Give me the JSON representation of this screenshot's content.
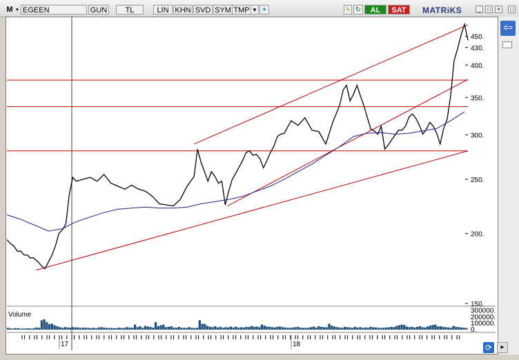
{
  "toolbar": {
    "app_letter": "M",
    "symbol": "EGEEN",
    "period": "GUN",
    "currency": "TL",
    "scale": "LIN",
    "buttons": [
      "KHN",
      "SVD",
      "SYM",
      "TMP"
    ],
    "buy_label": "AL",
    "sell_label": "SAT",
    "brand": "MATRiKS",
    "colors": {
      "buy": "#1a8a1a",
      "sell": "#c81e1e",
      "brand": "#2a3a7a"
    }
  },
  "chart_data": [
    {
      "type": "line",
      "title": "",
      "x_tick_labels": [
        "17",
        "18"
      ],
      "y_tick_labels": [
        "450.",
        "430.",
        "400.",
        "350.",
        "300.",
        "250.",
        "200.",
        "150."
      ],
      "y_scale": "log",
      "ylim": [
        150,
        480
      ],
      "grid": false,
      "series": [
        {
          "x": [
            0,
            5,
            10,
            15,
            20,
            25,
            30,
            33,
            38,
            45,
            50,
            55,
            60,
            65,
            70,
            75,
            80,
            85,
            90,
            95,
            100,
            110,
            120,
            130,
            140,
            150,
            160,
            170,
            180,
            190,
            200,
            210,
            220,
            230,
            240,
            250,
            260,
            270,
            275,
            280,
            285,
            290,
            295,
            300,
            305,
            310,
            315,
            320,
            325,
            330,
            335,
            340,
            345,
            350,
            355,
            360,
            365,
            370,
            375,
            380,
            385,
            390,
            395,
            400,
            410,
            420,
            430,
            440,
            450,
            460,
            470,
            480,
            485,
            490,
            495,
            500,
            505,
            510,
            515,
            520,
            525,
            530,
            535,
            540,
            545,
            550,
            555,
            560,
            565,
            570,
            575,
            580,
            585,
            590,
            595,
            600,
            605,
            610,
            615,
            620,
            625,
            630,
            635,
            640,
            645,
            650,
            655,
            660,
            665
          ],
          "values": [
            195,
            192,
            190,
            186,
            186,
            183,
            183,
            181,
            181,
            178,
            175,
            173,
            178,
            183,
            190,
            200,
            203,
            208,
            235,
            252,
            248,
            250,
            252,
            248,
            255,
            246,
            243,
            240,
            244,
            240,
            238,
            233,
            226,
            225,
            224,
            230,
            243,
            253,
            283,
            268,
            258,
            248,
            258,
            253,
            246,
            248,
            225,
            238,
            250,
            256,
            263,
            270,
            279,
            281,
            276,
            277,
            272,
            262,
            270,
            279,
            286,
            298,
            301,
            302,
            318,
            312,
            322,
            306,
            304,
            289,
            316,
            339,
            361,
            368,
            345,
            355,
            368,
            352,
            338,
            322,
            307,
            305,
            301,
            311,
            283,
            288,
            294,
            300,
            306,
            306,
            311,
            323,
            327,
            321,
            312,
            301,
            307,
            316,
            311,
            302,
            289,
            308,
            320,
            352,
            407,
            427,
            452,
            473,
            443
          ],
          "color": "#000000"
        },
        {
          "name": "",
          "x": [
            0,
            20,
            40,
            60,
            80,
            100,
            120,
            140,
            160,
            180,
            200,
            220,
            240,
            260,
            280,
            300,
            320,
            340,
            360,
            380,
            400,
            420,
            440,
            460,
            480,
            500,
            520,
            540,
            560,
            580,
            600,
            620,
            640,
            660
          ],
          "values": [
            216,
            212,
            207,
            202,
            204,
            210,
            214,
            218,
            221,
            222,
            223,
            222,
            222,
            223,
            226,
            228,
            230,
            233,
            238,
            243,
            250,
            258,
            266,
            276,
            286,
            298,
            302,
            303,
            301,
            302,
            305,
            308,
            318,
            330
          ],
          "color": "#1f1f8c"
        }
      ],
      "horizontal_lines": [
        {
          "value": 376,
          "color": "#c00000"
        },
        {
          "value": 337,
          "color": "#c00000"
        },
        {
          "value": 281,
          "color": "#c00000"
        }
      ],
      "trend_lines": [
        {
          "from": [
            42,
            172
          ],
          "to": [
            665,
            281
          ],
          "color": "#c00000"
        },
        {
          "from": [
            270,
            289
          ],
          "to": [
            665,
            472
          ],
          "color": "#c00000"
        },
        {
          "from": [
            318,
            224
          ],
          "to": [
            665,
            377
          ],
          "color": "#c00000"
        }
      ]
    },
    {
      "type": "bar",
      "title": "Volume",
      "y_tick_labels": [
        "300000.",
        "200000.",
        "100000.",
        "0."
      ],
      "ylim": [
        0,
        330000
      ],
      "values": [
        30000,
        20000,
        18000,
        25000,
        22000,
        15000,
        18000,
        20000,
        22000,
        17000,
        25000,
        35000,
        30000,
        150000,
        165000,
        120000,
        90000,
        95000,
        70000,
        55000,
        40000,
        30000,
        42000,
        36000,
        32000,
        40000,
        36000,
        35000,
        28000,
        30000,
        32000,
        27000,
        25000,
        30000,
        22000,
        35000,
        40000,
        32000,
        30000,
        25000,
        28000,
        22000,
        25000,
        32000,
        25000,
        30000,
        40000,
        32000,
        30000,
        80000,
        40000,
        55000,
        30000,
        60000,
        50000,
        42000,
        32000,
        120000,
        55000,
        70000,
        80000,
        40000,
        45000,
        55000,
        35000,
        30000,
        45000,
        30000,
        30000,
        28000,
        40000,
        30000,
        25000,
        30000,
        150000,
        95000,
        90000,
        60000,
        45000,
        40000,
        55000,
        35000,
        45000,
        30000,
        40000,
        35000,
        48000,
        35000,
        48000,
        30000,
        40000,
        35000,
        45000,
        40000,
        60000,
        45000,
        50000,
        40000,
        80000,
        65000,
        48000,
        45000,
        40000,
        35000,
        45000,
        50000,
        40000,
        35000,
        30000,
        30000,
        35000,
        40000,
        45000,
        30000,
        30000,
        28000,
        32000,
        40000,
        50000,
        35000,
        55000,
        45000,
        40000,
        38000,
        95000,
        65000,
        50000,
        40000,
        35000,
        30000,
        45000,
        40000,
        35000,
        30000,
        45000,
        32000,
        40000,
        30000,
        35000,
        30000,
        45000,
        38000,
        35000,
        30000,
        28000,
        32000,
        35000,
        38000,
        45000,
        40000,
        60000,
        70000,
        80000,
        75000,
        48000,
        40000,
        45000,
        35000,
        45000,
        55000,
        40000,
        35000,
        50000,
        65000,
        75000,
        80000,
        50000,
        55000,
        45000,
        40000,
        35000,
        30000,
        60000,
        45000,
        40000,
        35000,
        30000,
        25000
      ],
      "color": "#1f4e79"
    }
  ]
}
